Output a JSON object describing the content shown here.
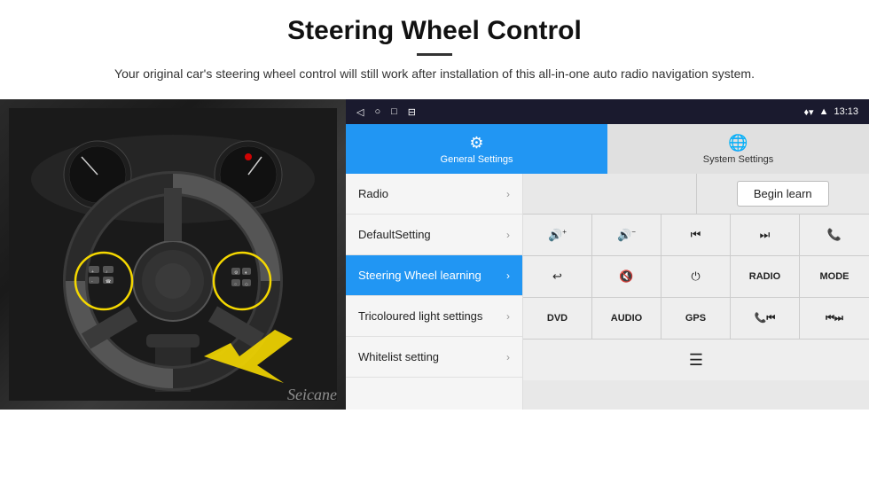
{
  "header": {
    "title": "Steering Wheel Control",
    "subtitle": "Your original car's steering wheel control will still work after installation of this all-in-one auto radio navigation system."
  },
  "statusbar": {
    "time": "13:13",
    "icons": [
      "◁",
      "○",
      "□",
      "⊟"
    ]
  },
  "tabs": [
    {
      "id": "general",
      "label": "General Settings",
      "icon": "⚙",
      "active": true
    },
    {
      "id": "system",
      "label": "System Settings",
      "icon": "🌐",
      "active": false
    }
  ],
  "menu": {
    "items": [
      {
        "label": "Radio",
        "active": false
      },
      {
        "label": "DefaultSetting",
        "active": false
      },
      {
        "label": "Steering Wheel learning",
        "active": true
      },
      {
        "label": "Tricoloured light settings",
        "active": false
      },
      {
        "label": "Whitelist setting",
        "active": false
      }
    ]
  },
  "content": {
    "begin_learn_label": "Begin learn",
    "icon_row1": [
      "🔊+",
      "🔊-",
      "⏮",
      "⏭",
      "📞"
    ],
    "icon_row2": [
      "↩",
      "🔇",
      "⏻",
      "RADIO",
      "MODE"
    ],
    "label_row": [
      "DVD",
      "AUDIO",
      "GPS",
      "📞⏮",
      "⏮⏭"
    ],
    "bottom_row": [
      "≡"
    ]
  },
  "watermark": "Seicane"
}
